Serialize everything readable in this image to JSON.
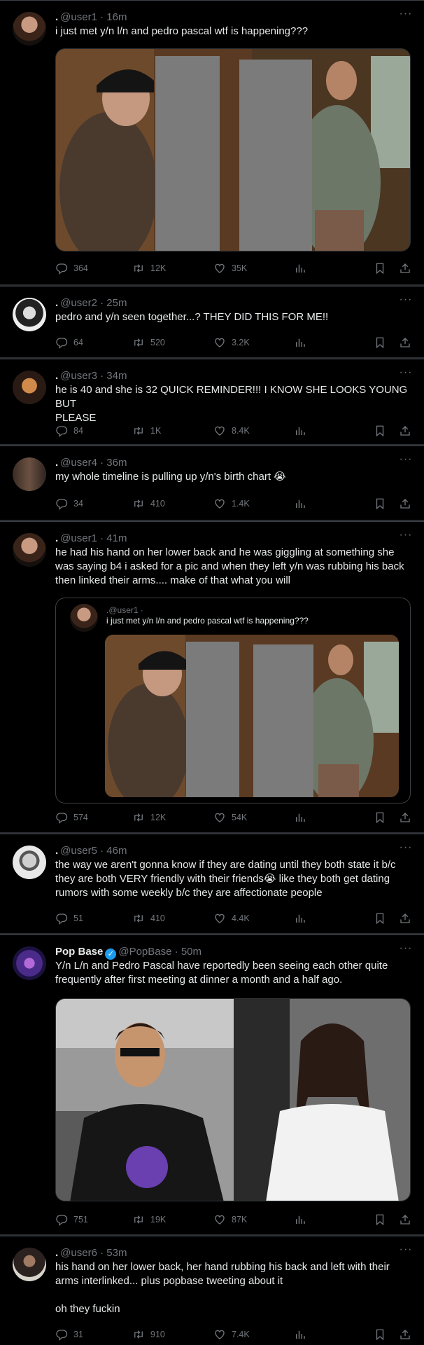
{
  "tweets": [
    {
      "handle": "@user1",
      "time": "16m",
      "text": "i just met y/n l/n and pedro pascal wtf is happening???",
      "reply": "364",
      "retweet": "12K",
      "like": "35K"
    },
    {
      "handle": "@user2",
      "time": "25m",
      "text": "pedro and y/n seen together...? THEY DID THIS FOR ME!!",
      "reply": "64",
      "retweet": "520",
      "like": "3.2K"
    },
    {
      "handle": "@user3",
      "time": "34m",
      "text": "he is 40 and she is 32 QUICK REMINDER!!! I KNOW SHE LOOKS YOUNG BUT\nPLEASE",
      "reply": "84",
      "retweet": "1K",
      "like": "8.4K"
    },
    {
      "handle": "@user4",
      "time": "36m",
      "text": "my whole timeline is pulling up y/n's birth chart 😭",
      "reply": "34",
      "retweet": "410",
      "like": "1.4K"
    },
    {
      "handle": "@user1",
      "time": "41m",
      "text": "he had his hand on her lower back and he was giggling at something she\nwas saying b4 i asked for a pic and when they left y/n was rubbing his back\nthen linked their arms.... make of that what you will",
      "reply": "574",
      "retweet": "12K",
      "like": "54K",
      "quote": {
        "handle": "@user1",
        "text": "i just met y/n l/n and pedro pascal wtf is happening???"
      }
    },
    {
      "handle": "@user5",
      "time": "46m",
      "text": "the way we aren't gonna know if they are dating until they both state it b/c\nthey are both VERY friendly with their friends😭 like they both get dating\nrumors with some weekly b/c they are affectionate people",
      "reply": "51",
      "retweet": "410",
      "like": "4.4K"
    },
    {
      "name": "Pop Base",
      "handle": "@PopBase",
      "time": "50m",
      "text": "Y/n L/n and Pedro Pascal have reportedly been seeing each other quite\nfrequently after first meeting at dinner a month and a half ago.",
      "reply": "751",
      "retweet": "19K",
      "like": "87K"
    },
    {
      "handle": "@user6",
      "time": "53m",
      "text": "his hand on her lower back, her hand rubbing his back and left with their\narms interlinked... plus popbase tweeting about it\n\noh they fuckin",
      "reply": "31",
      "retweet": "910",
      "like": "7.4K"
    }
  ],
  "separator": "·",
  "dot": ".",
  "more": "···",
  "verified_mark": "✓",
  "colors": {
    "bg": "#000000",
    "muted": "#71767b",
    "text": "#e7e9ea",
    "verified": "#1d9bf0"
  }
}
